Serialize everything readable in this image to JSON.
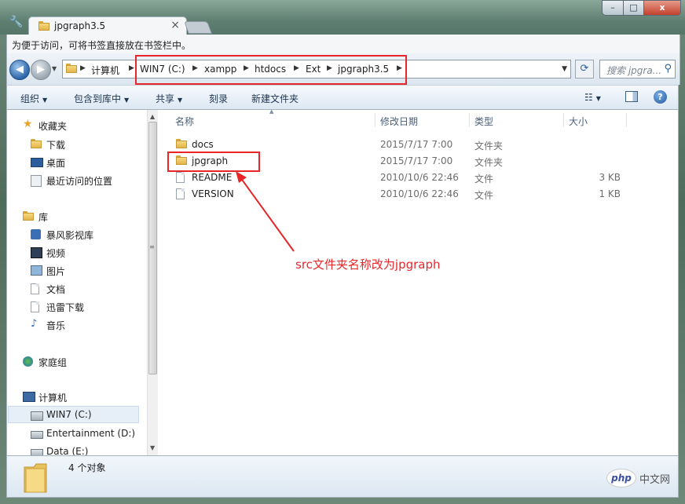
{
  "window": {
    "tab_title": "jpgraph3.5",
    "bookmark_hint": "为便于访问，可将书签直接放在书签栏中。",
    "controls": {
      "minimize": "–",
      "maximize": "□",
      "close": "x"
    }
  },
  "address": {
    "root_label": "计算机",
    "crumbs": [
      "WIN7 (C:)",
      "xampp",
      "htdocs",
      "Ext",
      "jpgraph3.5"
    ],
    "search_placeholder": "搜索 jpgra..."
  },
  "toolbar": {
    "organize": "组织",
    "include_in_library": "包含到库中",
    "share": "共享",
    "burn": "刻录",
    "new_folder": "新建文件夹"
  },
  "nav": {
    "favorites_header": "收藏夹",
    "favorites": [
      "下载",
      "桌面",
      "最近访问的位置"
    ],
    "library_header": "库",
    "libraries": [
      "暴风影视库",
      "视频",
      "图片",
      "文档",
      "迅雷下载",
      "音乐"
    ],
    "homegroup": "家庭组",
    "computer_header": "计算机",
    "drives": [
      "WIN7 (C:)",
      "Entertainment (D:)",
      "Data (E:)"
    ]
  },
  "columns": {
    "name": "名称",
    "date": "修改日期",
    "type": "类型",
    "size": "大小"
  },
  "files": [
    {
      "name": "docs",
      "date": "2015/7/17 7:00",
      "type": "文件夹",
      "size": "",
      "icon": "folder-icon"
    },
    {
      "name": "jpgraph",
      "date": "2015/7/17 7:00",
      "type": "文件夹",
      "size": "",
      "icon": "folder-icon"
    },
    {
      "name": "README",
      "date": "2010/10/6 22:46",
      "type": "文件",
      "size": "3 KB",
      "icon": "file-icon"
    },
    {
      "name": "VERSION",
      "date": "2010/10/6 22:46",
      "type": "文件",
      "size": "1 KB",
      "icon": "file-icon"
    }
  ],
  "annotation": "src文件夹名称改为jpgraph",
  "annotation_color": "#e8262a",
  "status": {
    "count": "4 个对象"
  },
  "watermark": {
    "logo": "php",
    "text": "中文网"
  }
}
